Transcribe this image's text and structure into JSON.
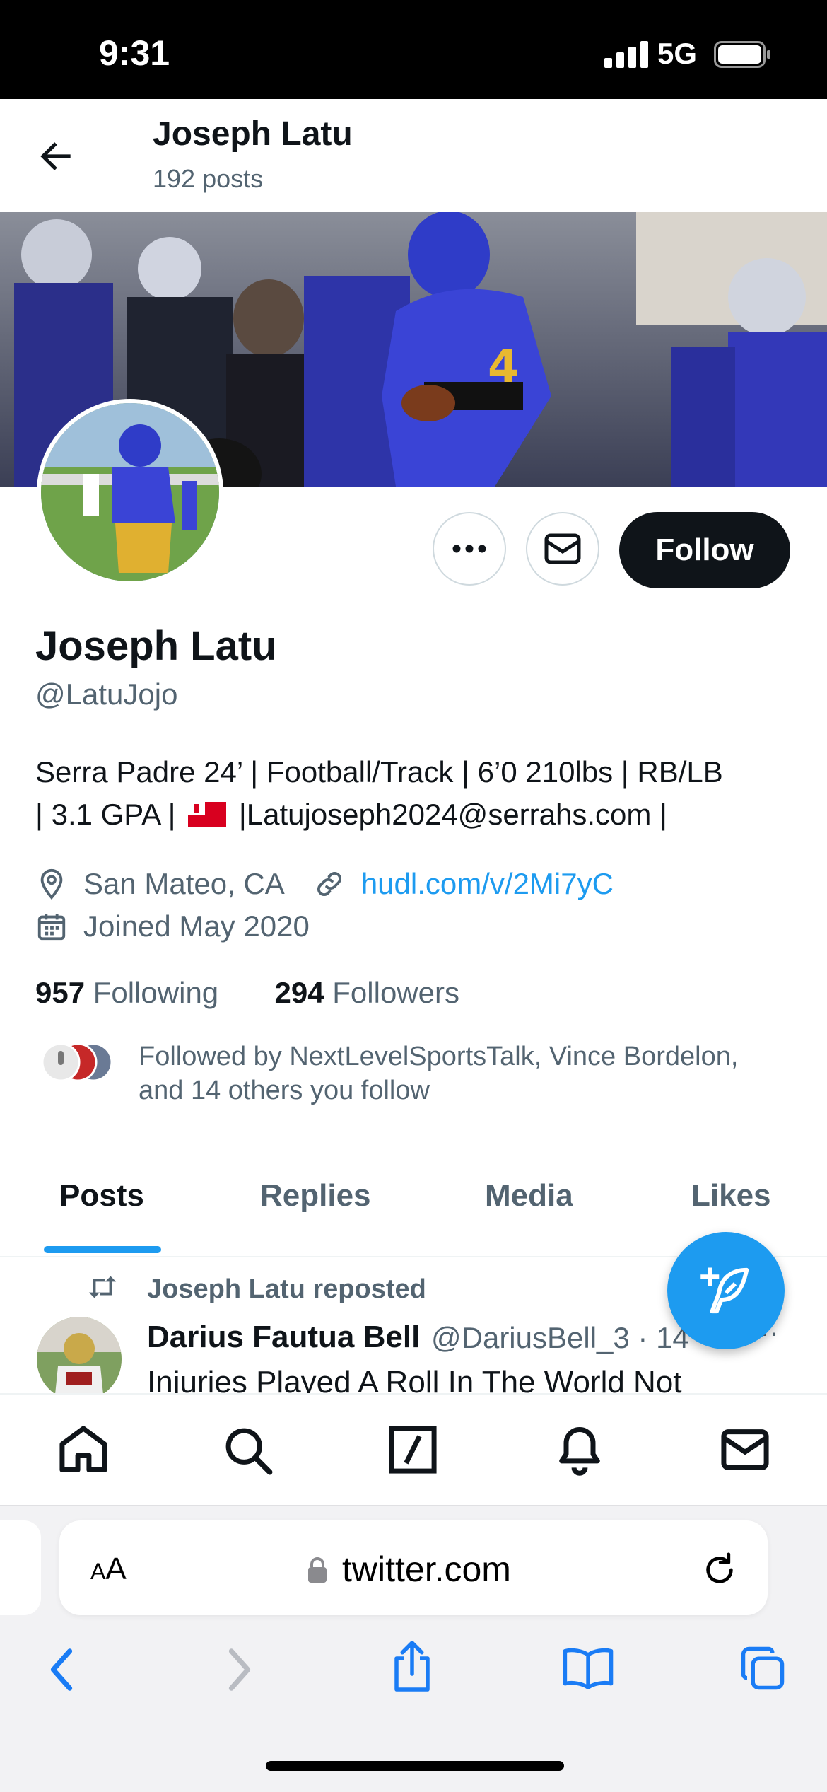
{
  "status_bar": {
    "time": "9:31",
    "network": "5G"
  },
  "header": {
    "title": "Joseph Latu",
    "post_count": "192 posts"
  },
  "profile": {
    "name": "Joseph Latu",
    "handle": "@LatuJojo",
    "bio_line1": "Serra Padre 24’ | Football/Track | 6’0 210lbs | RB/LB",
    "bio_line2_a": "| 3.1 GPA |",
    "bio_line2_b": "|Latujoseph2024@serrahs.com |",
    "location": "San Mateo, CA",
    "link": "hudl.com/v/2Mi7yC",
    "joined": "Joined May 2020",
    "following_count": "957",
    "following_label": "Following",
    "followers_count": "294",
    "followers_label": "Followers",
    "followed_by_line1": "Followed by NextLevelSportsTalk, Vince Bordelon,",
    "followed_by_line2": "and 14 others you follow",
    "follow_button": "Follow"
  },
  "tabs": [
    "Posts",
    "Replies",
    "Media",
    "Likes"
  ],
  "post_preview": {
    "repost_label": "Joseph Latu reposted",
    "author": "Darius Fautua Bell",
    "handle": "@DariusBell_3 · 14",
    "more": "···",
    "text": "Injuries Played A Roll In The World Not"
  },
  "browser": {
    "aa_small": "A",
    "aa_large": "A",
    "url": "twitter.com"
  },
  "colors": {
    "accent": "#1d9bf0",
    "text": "#0f1419",
    "muted": "#536471"
  },
  "icons": [
    "back-arrow-icon",
    "more-icon",
    "mail-icon",
    "location-pin-icon",
    "link-icon",
    "calendar-icon",
    "repost-icon",
    "compose-icon",
    "home-icon",
    "search-icon",
    "slash-icon",
    "bell-icon",
    "mail-icon",
    "lock-icon",
    "reload-icon",
    "back-chevron-icon",
    "forward-chevron-icon",
    "share-icon",
    "bookmarks-icon",
    "tabs-icon"
  ]
}
